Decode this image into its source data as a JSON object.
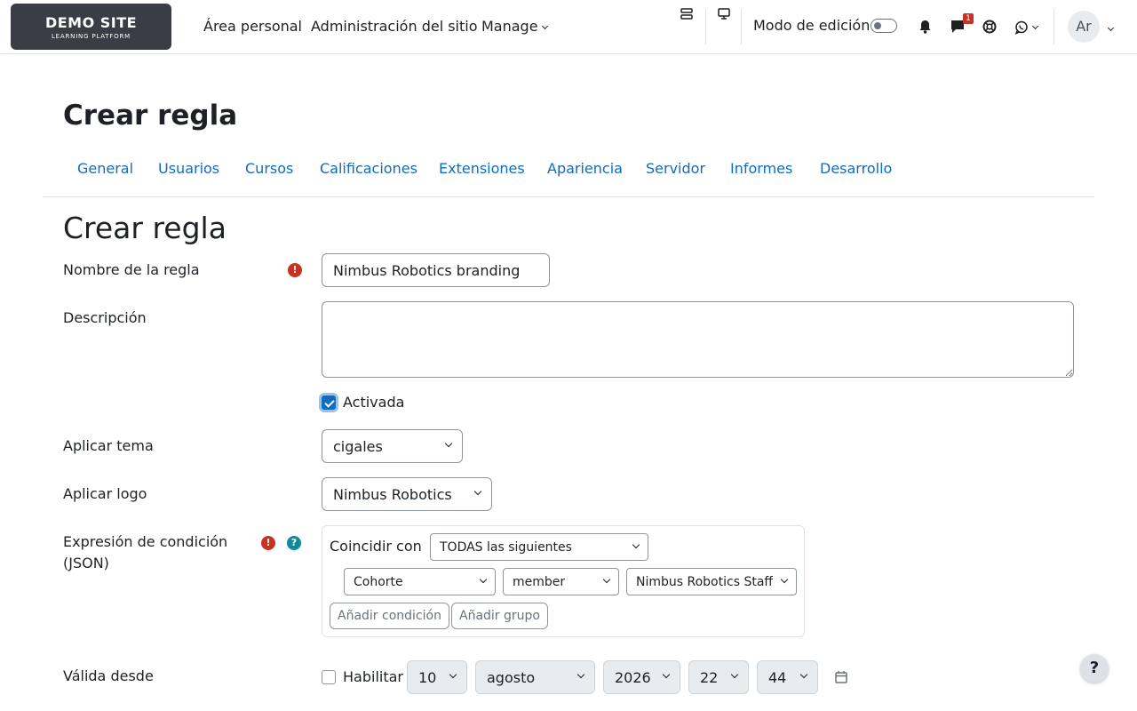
{
  "navbar": {
    "logo_title": "DEMO SITE",
    "logo_subtitle": "LEARNING PLATFORM",
    "links": [
      "Área personal",
      "Administración del sitio",
      "Manage"
    ],
    "edit_mode_label": "Modo de edición",
    "messages_badge": "1",
    "avatar_initials": "Ar"
  },
  "page_heading": "Crear regla",
  "tabs": [
    "General",
    "Usuarios",
    "Cursos",
    "Calificaciones",
    "Extensiones",
    "Apariencia",
    "Servidor",
    "Informes",
    "Desarrollo"
  ],
  "form": {
    "title": "Crear regla",
    "rule_name": {
      "label": "Nombre de la regla",
      "value": "Nimbus Robotics branding"
    },
    "description": {
      "label": "Descripción",
      "value": ""
    },
    "enabled": {
      "label": "Activada",
      "checked": true
    },
    "theme": {
      "label": "Aplicar tema",
      "value": "cigales"
    },
    "logo": {
      "label": "Aplicar logo",
      "value": "Nimbus Robotics"
    },
    "condition": {
      "label_line1": "Expresión de condición",
      "label_line2": "(JSON)",
      "match_label": "Coincidir con",
      "match_value": "TODAS las siguientes",
      "field_value": "Cohorte",
      "operator_value": "member",
      "target_value": "Nimbus Robotics Staff",
      "add_condition": "Añadir condición",
      "add_group": "Añadir grupo"
    },
    "valid_from": {
      "label": "Válida desde",
      "enable_label": "Habilitar",
      "enable_checked": false,
      "day": "10",
      "month": "agosto",
      "year": "2026",
      "hour": "22",
      "minute": "44"
    }
  },
  "help_fab": "?",
  "colors": {
    "link": "#0f6cbf",
    "required": "#ca3120",
    "help": "#0f8a9d",
    "logo_bg": "#3a3d45"
  }
}
